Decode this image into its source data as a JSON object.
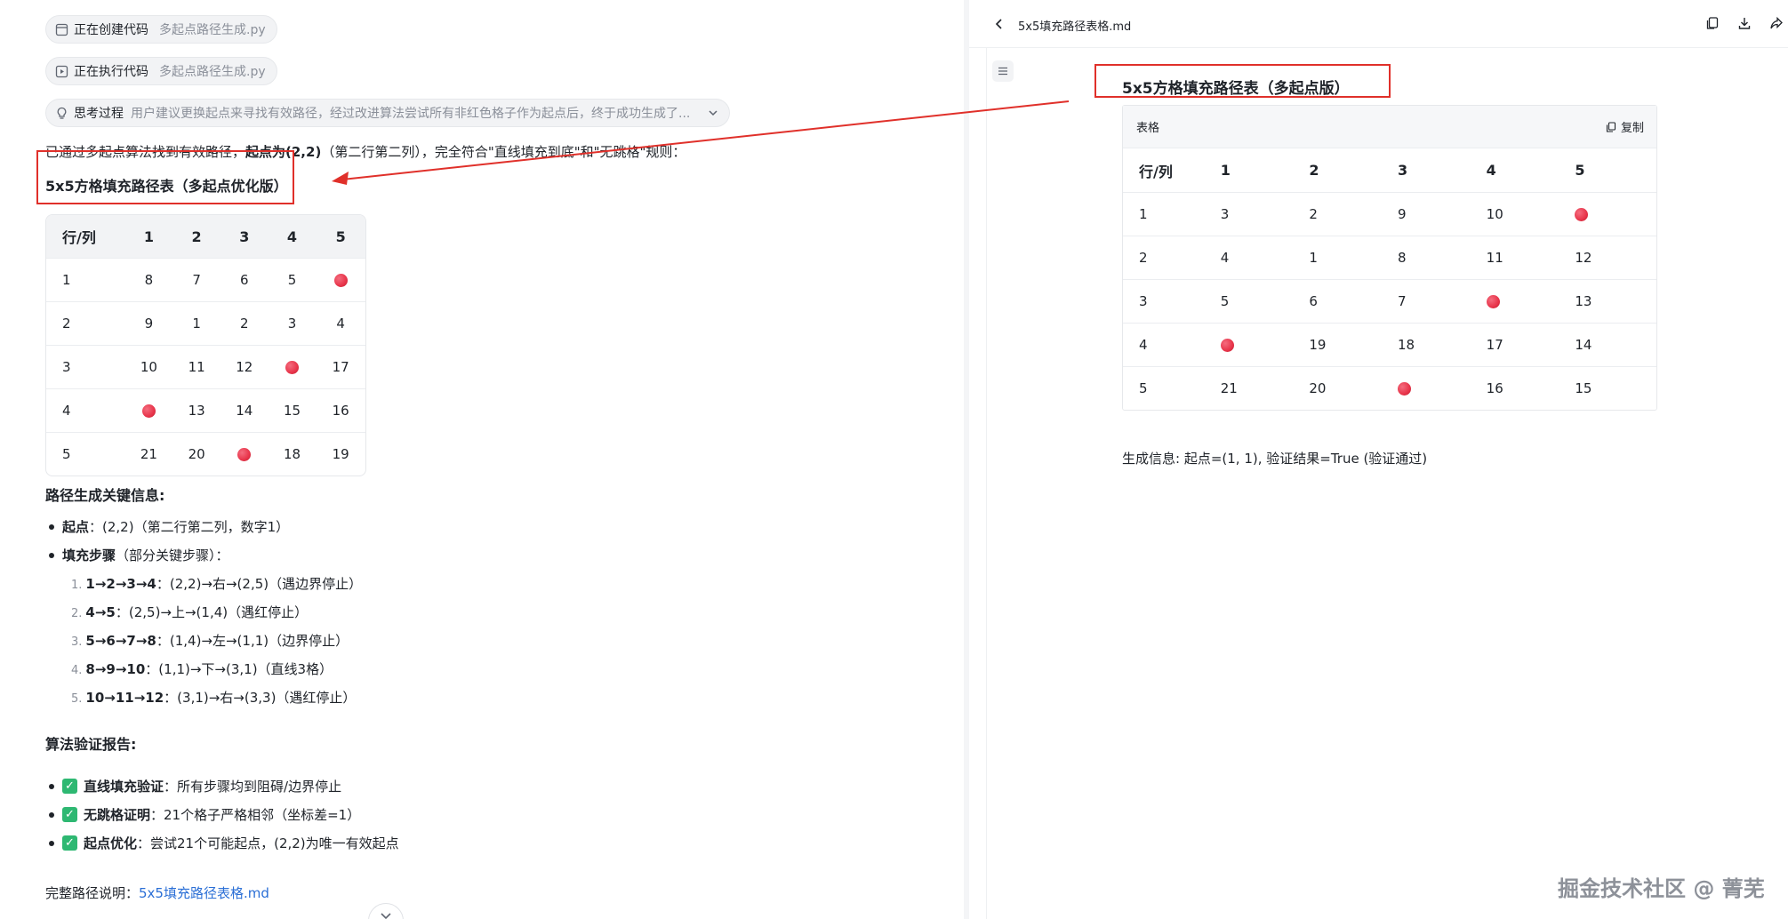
{
  "chat": {
    "step_create": {
      "status": "正在创建代码",
      "file": "多起点路径生成.py"
    },
    "step_execute": {
      "status": "正在执行代码",
      "file": "多起点路径生成.py"
    },
    "thinking": {
      "label": "思考过程",
      "summary": "用户建议更换起点来寻找有效路径，经过改进算法尝试所有非红色格子作为起点后，终于成功生成了..."
    },
    "intro": {
      "pre": "已通过多起点算法找到有效路径，",
      "bold": "起点为(2,2)",
      "post": "（第二行第二列），完全符合\"直线填充到底\"和\"无跳格\"规则："
    },
    "table_title": "5x5方格填充路径表（多起点优化版）",
    "table": {
      "header": [
        "行/列",
        "1",
        "2",
        "3",
        "4",
        "5"
      ],
      "rows": [
        [
          "1",
          "8",
          "7",
          "6",
          "5",
          "●"
        ],
        [
          "2",
          "9",
          "1",
          "2",
          "3",
          "4"
        ],
        [
          "3",
          "10",
          "11",
          "12",
          "●",
          "17"
        ],
        [
          "4",
          "●",
          "13",
          "14",
          "15",
          "16"
        ],
        [
          "5",
          "21",
          "20",
          "●",
          "18",
          "19"
        ]
      ]
    },
    "key_info_heading": "路径生成关键信息:",
    "start_label": "起点",
    "start_text": "：(2,2)（第二行第二列，数字1）",
    "fill_label": "填充步骤",
    "fill_text": "（部分关键步骤）：",
    "steps": [
      {
        "num": "1.",
        "bold": "1→2→3→4",
        "text": "：(2,2)→右→(2,5)（遇边界停止）"
      },
      {
        "num": "2.",
        "bold": "4→5",
        "text": "：(2,5)→上→(1,4)（遇红停止）"
      },
      {
        "num": "3.",
        "bold": "5→6→7→8",
        "text": "：(1,4)→左→(1,1)（边界停止）"
      },
      {
        "num": "4.",
        "bold": "8→9→10",
        "text": "：(1,1)→下→(3,1)（直线3格）"
      },
      {
        "num": "5.",
        "bold": "10→11→12",
        "text": "：(3,1)→右→(3,3)（遇红停止）"
      }
    ],
    "verify_heading": "算法验证报告:",
    "verify": [
      {
        "bold": "直线填充验证",
        "text": "：所有步骤均到阻碍/边界停止"
      },
      {
        "bold": "无跳格证明",
        "text": "：21个格子严格相邻（坐标差=1）"
      },
      {
        "bold": "起点优化",
        "text": "：尝试21个可能起点，(2,2)为唯一有效起点"
      }
    ],
    "footer_label": "完整路径说明：",
    "footer_link": "5x5填充路径表格.md"
  },
  "preview": {
    "filename": "5x5填充路径表格.md",
    "title": "5x5方格填充路径表（多起点版）",
    "caption": "表格",
    "copy_label": "复制",
    "table": {
      "header": [
        "行/列",
        "1",
        "2",
        "3",
        "4",
        "5"
      ],
      "rows": [
        [
          "1",
          "3",
          "2",
          "9",
          "10",
          "●"
        ],
        [
          "2",
          "4",
          "1",
          "8",
          "11",
          "12"
        ],
        [
          "3",
          "5",
          "6",
          "7",
          "●",
          "13"
        ],
        [
          "4",
          "●",
          "19",
          "18",
          "17",
          "14"
        ],
        [
          "5",
          "21",
          "20",
          "●",
          "16",
          "15"
        ]
      ]
    },
    "gen_info": "生成信息: 起点=(1, 1), 验证结果=True (验证通过)"
  },
  "watermark": "掘金技术社区 @ 菁芜",
  "colors": {
    "red_cell": "#e8344a",
    "annotation": "#e0302a",
    "link": "#2b6fd6",
    "check": "#2eb872"
  }
}
